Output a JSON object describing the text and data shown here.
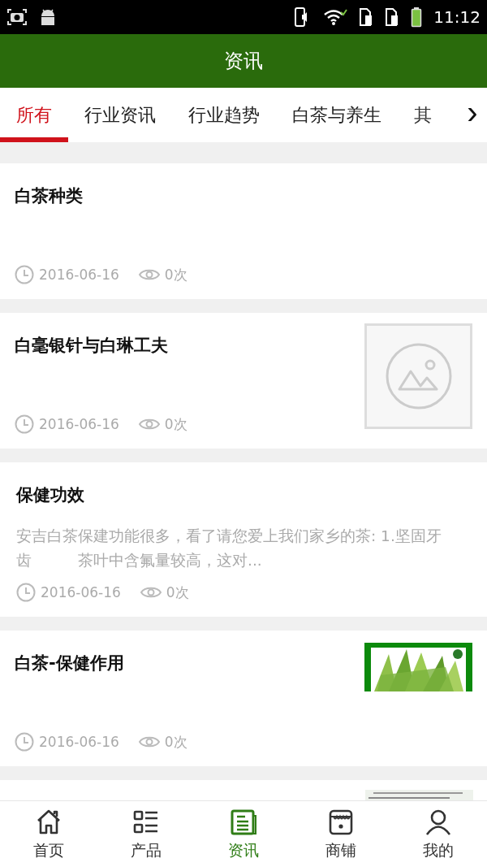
{
  "status_bar": {
    "time": "11:12"
  },
  "header": {
    "title": "资讯"
  },
  "tabs": [
    {
      "label": "所有",
      "selected": true
    },
    {
      "label": "行业资讯",
      "selected": false
    },
    {
      "label": "行业趋势",
      "selected": false
    },
    {
      "label": "白茶与养生",
      "selected": false
    },
    {
      "label": "其",
      "selected": false
    }
  ],
  "tabs_more": "›",
  "articles": [
    {
      "kind": "plain",
      "title": "白茶种类",
      "date": "2016-06-16",
      "views": "0次"
    },
    {
      "kind": "placeholder",
      "title": "白毫银针与白琳工夫",
      "date": "2016-06-16",
      "views": "0次"
    },
    {
      "kind": "summary",
      "title": "保健功效",
      "summary": "安吉白茶保建功能很多，看了请您爱上我们家乡的茶: 1.坚固牙齿　　　茶叶中含氟量较高，这对...",
      "date": "2016-06-16",
      "views": "0次"
    },
    {
      "kind": "picture",
      "title": "白茶-保健作用",
      "date": "2016-06-16",
      "views": "0次"
    },
    {
      "kind": "picture-partial"
    }
  ],
  "bottom_nav": [
    {
      "label": "首页",
      "kind": "home",
      "selected": false
    },
    {
      "label": "产品",
      "kind": "list",
      "selected": false
    },
    {
      "label": "资讯",
      "kind": "news",
      "selected": true
    },
    {
      "label": "商铺",
      "kind": "shop",
      "selected": false
    },
    {
      "label": "我的",
      "kind": "user",
      "selected": false
    }
  ]
}
